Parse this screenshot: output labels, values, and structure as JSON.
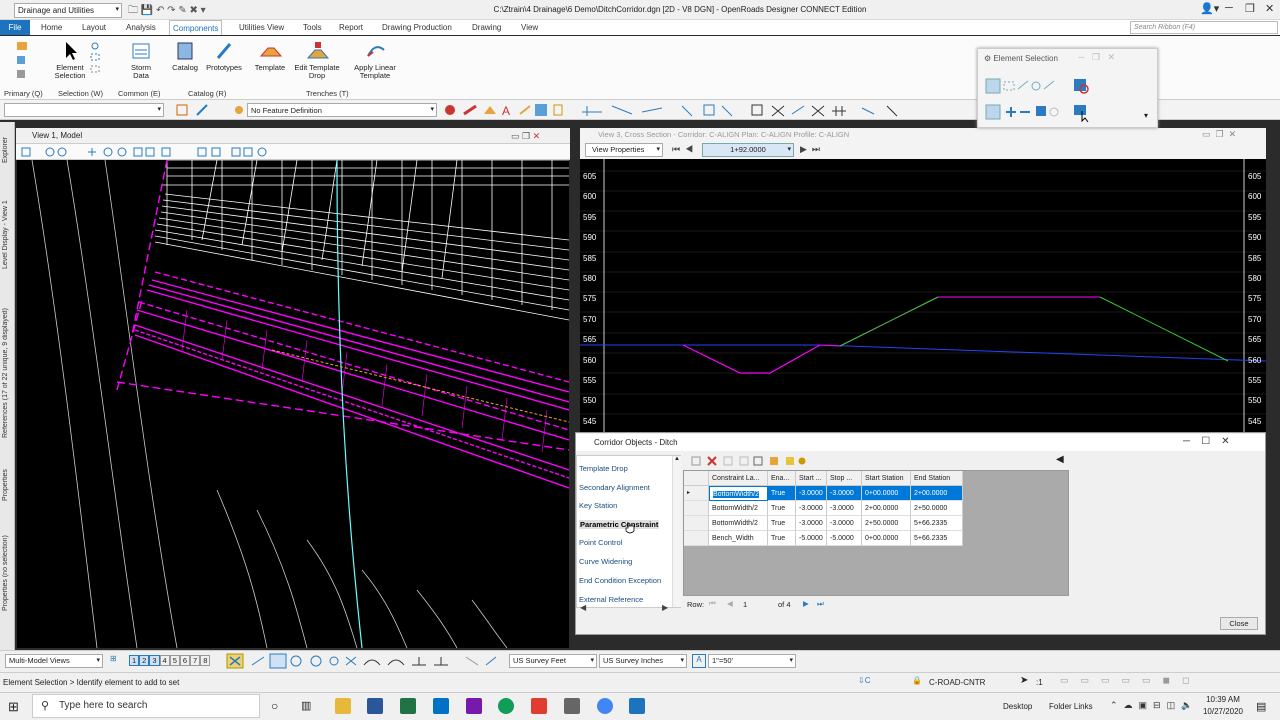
{
  "titlebar": {
    "workspace": "Drainage and Utilities",
    "document": "C:\\Ztrain\\4 Drainage\\6 Demo\\DitchCorridor.dgn [2D - V8 DGN] - OpenRoads Designer CONNECT Edition"
  },
  "tabs": [
    "File",
    "Home",
    "Layout",
    "Analysis",
    "Components",
    "Utilities View",
    "Tools",
    "Report",
    "Drawing Production",
    "Drawing",
    "View"
  ],
  "search_ribbon": "Search Ribbon (F4)",
  "ribbon": {
    "buttons": [
      "Element Selection",
      "Storm Data",
      "Catalog",
      "Prototypes",
      "Template",
      "Edit Template Drop",
      "Apply Linear Template"
    ],
    "groups": [
      "Primary (Q)",
      "Selection (W)",
      "Common (E)",
      "Catalog (R)",
      "Trenches (T)"
    ]
  },
  "feature_definition": "No Feature Definition",
  "left_rail": [
    "Explorer",
    "Level Display - View 1",
    "References (17 of 22 unique, 9 displayed)",
    "Properties",
    "Properties (no selection)"
  ],
  "view1": {
    "title": "View 1, Model"
  },
  "view3": {
    "title": "View 3, Cross Section - Corridor: C-ALIGN Plan: C-ALIGN Profile: C-ALIGN",
    "view_properties": "View Properties",
    "station": "1+92.0000",
    "elevations": [
      "605",
      "600",
      "595",
      "590",
      "585",
      "580",
      "575",
      "570",
      "565",
      "560",
      "555",
      "550",
      "545"
    ]
  },
  "element_selection": {
    "title": "Element Selection"
  },
  "corridor_objects": {
    "title": "Corridor Objects - Ditch",
    "list": [
      "Template Drop",
      "Secondary Alignment",
      "Key Station",
      "Parametric Constraint",
      "Point Control",
      "Curve Widening",
      "End Condition Exception",
      "External Reference"
    ],
    "selected": "Parametric Constraint",
    "columns": [
      "Constraint La...",
      "Ena...",
      "Start ...",
      "Stop ...",
      "Start Station",
      "End Station"
    ],
    "rows": [
      [
        "BottomWidth/2",
        "True",
        "-3.0000",
        "-3.0000",
        "0+00.0000",
        "2+00.0000"
      ],
      [
        "BottomWidth/2",
        "True",
        "-3.0000",
        "-3.0000",
        "2+00.0000",
        "2+50.0000"
      ],
      [
        "BottomWidth/2",
        "True",
        "-3.0000",
        "-3.0000",
        "2+50.0000",
        "5+66.2335"
      ],
      [
        "Bench_Width",
        "True",
        "-5.0000",
        "-5.0000",
        "0+00.0000",
        "5+66.2335"
      ]
    ],
    "row_label": "Row:",
    "row_current": "1",
    "row_total": "of 4",
    "close": "Close"
  },
  "bottom": {
    "views": "Multi-Model Views",
    "unit1": "US Survey Feet",
    "unit2": "US Survey Inches",
    "scale": "1\"=50'",
    "view_numbers": [
      "1",
      "2",
      "3",
      "4",
      "5",
      "6",
      "7",
      "8"
    ]
  },
  "status": {
    "text": "Element Selection > Identify element to add to set",
    "level": "C-ROAD-CNTR",
    "ratio": ":1"
  },
  "taskbar": {
    "search": "Type here to search",
    "desktop": "Desktop",
    "folder_links": "Folder Links",
    "time": "10:39 AM",
    "date": "10/27/2020"
  }
}
